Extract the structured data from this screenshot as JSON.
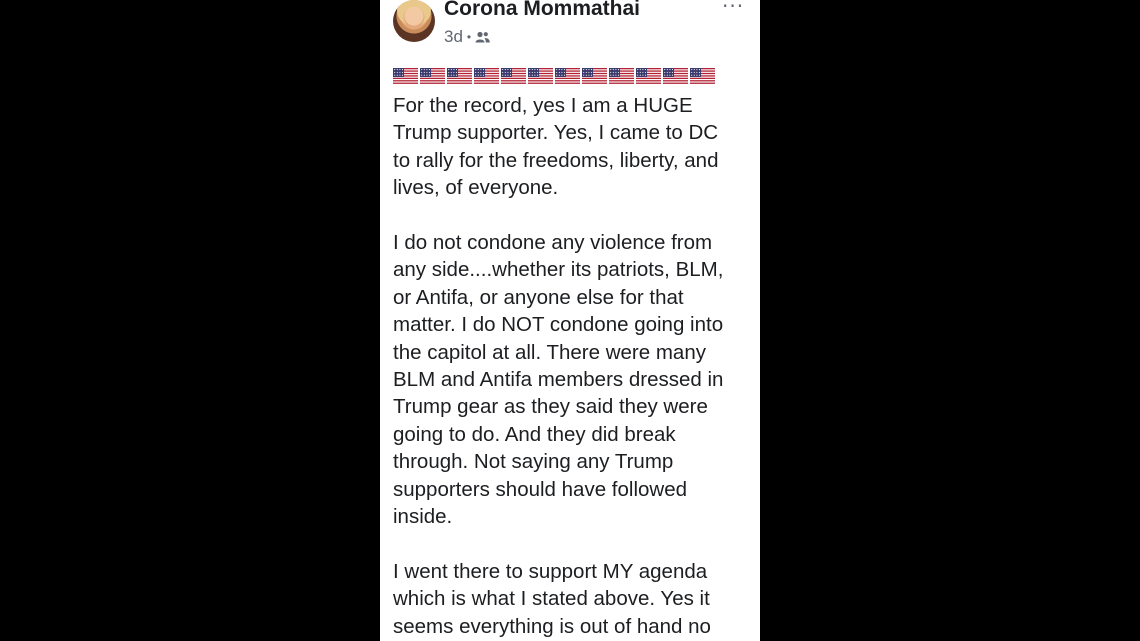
{
  "post": {
    "author": "Corona Mommathai",
    "timestamp": "3d",
    "separator": "•",
    "audience_icon": "friends-icon",
    "more_icon": "···",
    "flag_emoji_count": 12,
    "paragraphs": [
      {
        "lines": [
          "For the record, yes I am a HUGE",
          "Trump supporter.  Yes, I came to DC",
          "to rally for the freedoms, liberty, and",
          "lives, of everyone."
        ]
      },
      {
        "lines": [
          "I do not condone any violence from",
          "any side....whether its patriots, BLM,",
          "or Antifa, or anyone else for that",
          "matter. I do NOT condone going into",
          "the capitol at all. There were many",
          "BLM and Antifa members dressed in",
          "Trump gear as they said they were",
          "going to do. And they did break",
          "through. Not saying any Trump",
          "supporters should have followed",
          "inside."
        ]
      },
      {
        "lines": [
          "I went there to support MY agenda",
          "which is what I stated above. Yes it",
          "seems everything is out of hand no"
        ]
      }
    ]
  },
  "colors": {
    "background": "#000000",
    "card": "#ffffff",
    "text": "#1c1e21",
    "secondary_text": "#606770",
    "flag_red": "#b22234",
    "flag_blue": "#3c3b6e"
  }
}
